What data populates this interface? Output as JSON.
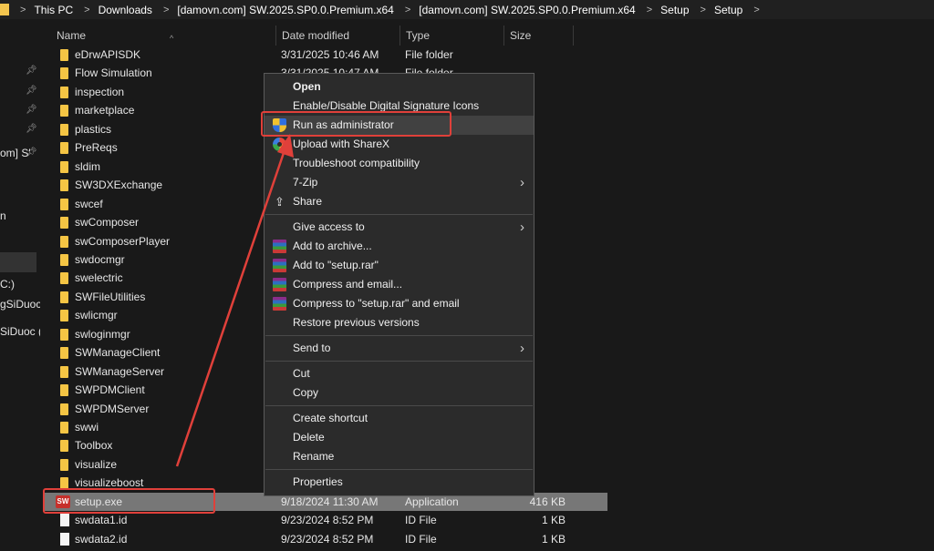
{
  "breadcrumb": {
    "items": [
      "This PC",
      "Downloads",
      "[damovn.com] SW.2025.SP0.0.Premium.x64",
      "[damovn.com] SW.2025.SP0.0.Premium.x64",
      "Setup",
      "Setup"
    ]
  },
  "navpane": {
    "labels": [
      "om] S'",
      "n",
      "C:)",
      "gSiDuoc",
      "SiDuoc ("
    ]
  },
  "columns": {
    "name": "Name",
    "date": "Date modified",
    "type": "Type",
    "size": "Size"
  },
  "files": [
    {
      "name": "eDrwAPISDK",
      "date": "3/31/2025 10:46 AM",
      "type": "File folder",
      "size": "",
      "icon": "folder-icon"
    },
    {
      "name": "Flow Simulation",
      "date": "3/31/2025 10:47 AM",
      "type": "File folder",
      "size": "",
      "icon": "folder-icon"
    },
    {
      "name": "inspection",
      "date": "",
      "type": "",
      "size": "",
      "icon": "folder-icon"
    },
    {
      "name": "marketplace",
      "date": "",
      "type": "",
      "size": "",
      "icon": "folder-icon"
    },
    {
      "name": "plastics",
      "date": "",
      "type": "",
      "size": "",
      "icon": "folder-icon"
    },
    {
      "name": "PreReqs",
      "date": "",
      "type": "",
      "size": "",
      "icon": "folder-icon"
    },
    {
      "name": "sldim",
      "date": "",
      "type": "",
      "size": "",
      "icon": "folder-icon"
    },
    {
      "name": "SW3DXExchange",
      "date": "",
      "type": "",
      "size": "",
      "icon": "folder-icon"
    },
    {
      "name": "swcef",
      "date": "",
      "type": "",
      "size": "",
      "icon": "folder-icon"
    },
    {
      "name": "swComposer",
      "date": "",
      "type": "",
      "size": "",
      "icon": "folder-icon"
    },
    {
      "name": "swComposerPlayer",
      "date": "",
      "type": "",
      "size": "",
      "icon": "folder-icon"
    },
    {
      "name": "swdocmgr",
      "date": "",
      "type": "",
      "size": "",
      "icon": "folder-icon"
    },
    {
      "name": "swelectric",
      "date": "",
      "type": "",
      "size": "",
      "icon": "folder-icon"
    },
    {
      "name": "SWFileUtilities",
      "date": "",
      "type": "",
      "size": "",
      "icon": "folder-icon"
    },
    {
      "name": "swlicmgr",
      "date": "",
      "type": "",
      "size": "",
      "icon": "folder-icon"
    },
    {
      "name": "swloginmgr",
      "date": "",
      "type": "",
      "size": "",
      "icon": "folder-icon"
    },
    {
      "name": "SWManageClient",
      "date": "",
      "type": "",
      "size": "",
      "icon": "folder-icon"
    },
    {
      "name": "SWManageServer",
      "date": "",
      "type": "",
      "size": "",
      "icon": "folder-icon"
    },
    {
      "name": "SWPDMClient",
      "date": "",
      "type": "",
      "size": "",
      "icon": "folder-icon"
    },
    {
      "name": "SWPDMServer",
      "date": "",
      "type": "",
      "size": "",
      "icon": "folder-icon"
    },
    {
      "name": "swwi",
      "date": "",
      "type": "",
      "size": "",
      "icon": "folder-icon"
    },
    {
      "name": "Toolbox",
      "date": "",
      "type": "",
      "size": "",
      "icon": "folder-icon"
    },
    {
      "name": "visualize",
      "date": "",
      "type": "",
      "size": "",
      "icon": "folder-icon"
    },
    {
      "name": "visualizeboost",
      "date": "",
      "type": "",
      "size": "",
      "icon": "folder-icon"
    },
    {
      "name": "setup.exe",
      "date": "9/18/2024 11:30 AM",
      "type": "Application",
      "size": "416 KB",
      "icon": "solidworks-exe-icon",
      "selected": true
    },
    {
      "name": "swdata1.id",
      "date": "9/23/2024 8:52 PM",
      "type": "ID File",
      "size": "1 KB",
      "icon": "file-icon"
    },
    {
      "name": "swdata2.id",
      "date": "9/23/2024 8:52 PM",
      "type": "ID File",
      "size": "1 KB",
      "icon": "file-icon"
    }
  ],
  "context_menu": {
    "items": [
      {
        "label": "Open",
        "bold": true,
        "icon": ""
      },
      {
        "label": "Enable/Disable Digital Signature Icons",
        "icon": ""
      },
      {
        "label": "Run as administrator",
        "icon": "uac-shield-icon",
        "highlight": true
      },
      {
        "label": "Upload with ShareX",
        "icon": "sharex-icon"
      },
      {
        "label": "Troubleshoot compatibility",
        "icon": ""
      },
      {
        "label": "7-Zip",
        "icon": "",
        "submenu": true
      },
      {
        "label": "Share",
        "icon": "share-icon"
      },
      {
        "separator": true
      },
      {
        "label": "Give access to",
        "icon": "",
        "submenu": true
      },
      {
        "label": "Add to archive...",
        "icon": "winrar-icon"
      },
      {
        "label": "Add to \"setup.rar\"",
        "icon": "winrar-icon"
      },
      {
        "label": "Compress and email...",
        "icon": "winrar-icon"
      },
      {
        "label": "Compress to \"setup.rar\" and email",
        "icon": "winrar-icon"
      },
      {
        "label": "Restore previous versions",
        "icon": ""
      },
      {
        "separator": true
      },
      {
        "label": "Send to",
        "icon": "",
        "submenu": true
      },
      {
        "separator": true
      },
      {
        "label": "Cut",
        "icon": ""
      },
      {
        "label": "Copy",
        "icon": ""
      },
      {
        "separator": true
      },
      {
        "label": "Create shortcut",
        "icon": ""
      },
      {
        "label": "Delete",
        "icon": ""
      },
      {
        "label": "Rename",
        "icon": ""
      },
      {
        "separator": true
      },
      {
        "label": "Properties",
        "icon": ""
      }
    ]
  },
  "colors": {
    "background": "#191919",
    "menu_background": "#2b2b2b",
    "selection": "#777777",
    "annotation_red": "#e0403a",
    "folder_yellow": "#f5c544"
  }
}
